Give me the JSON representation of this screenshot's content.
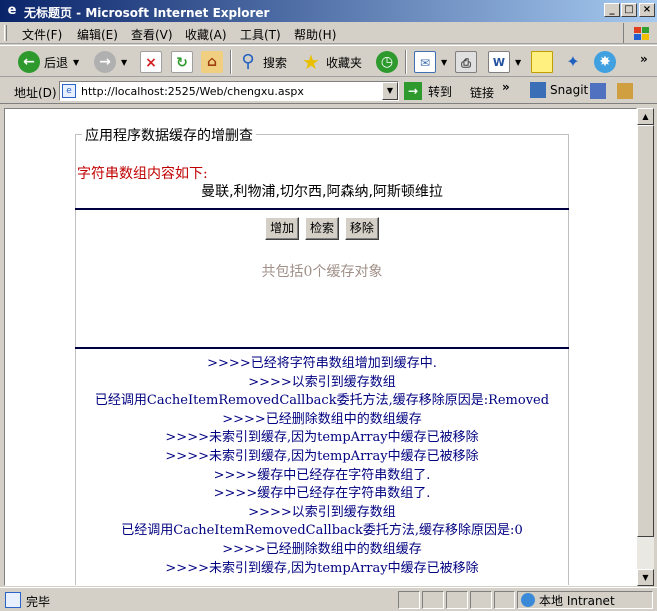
{
  "window": {
    "title": "无标题页 - Microsoft Internet Explorer",
    "controls": [
      "_",
      "□",
      "×"
    ]
  },
  "menu": [
    "文件(F)",
    "编辑(E)",
    "查看(V)",
    "收藏(A)",
    "工具(T)",
    "帮助(H)"
  ],
  "toolbar": {
    "back_label": "后退",
    "search_label": "搜索",
    "favorites_label": "收藏夹"
  },
  "address": {
    "label": "地址(D)",
    "url": "http://localhost:2525/Web/chengxu.aspx",
    "go_label": "转到",
    "links_label": "链接",
    "snagit_label": "Snagit"
  },
  "page": {
    "legend": "应用程序数据缓存的增删查",
    "string_heading": "字符串数组内容如下:",
    "string_content": "曼联,利物浦,切尔西,阿森纳,阿斯顿维拉",
    "buttons": {
      "add": "增加",
      "search": "检索",
      "remove": "移除"
    },
    "cache_count": "共包括0个缓存对象",
    "log": [
      ">>>>已经将字符串数组增加到缓存中.",
      ">>>>以索引到缓存数组",
      "已经调用CacheItemRemovedCallback委托方法,缓存移除原因是:Removed",
      ">>>>已经删除数组中的数组缓存",
      ">>>>未索引到缓存,因为tempArray中缓存已被移除",
      ">>>>未索引到缓存,因为tempArray中缓存已被移除",
      ">>>>缓存中已经存在字符串数组了.",
      ">>>>缓存中已经存在字符串数组了.",
      ">>>>以索引到缓存数组",
      "已经调用CacheItemRemovedCallback委托方法,缓存移除原因是:0",
      ">>>>已经删除数组中的数组缓存",
      ">>>>未索引到缓存,因为tempArray中缓存已被移除"
    ]
  },
  "status": {
    "text": "完毕",
    "zone": "本地 Intranet"
  }
}
